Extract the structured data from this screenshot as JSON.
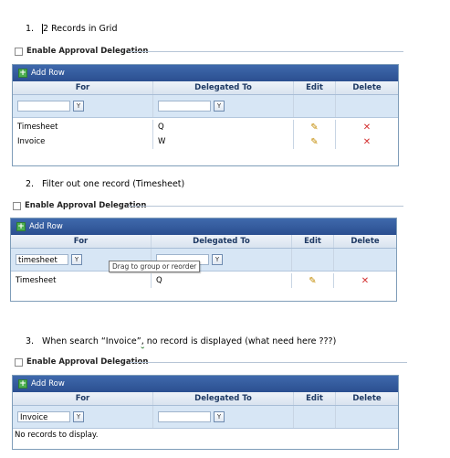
{
  "steps": [
    {
      "number": "1.",
      "cursor": "2",
      "text": " Records in Grid"
    },
    {
      "number": "2.",
      "text": "Filter out one record (Timesheet)"
    },
    {
      "number": "3.",
      "text_before": "When search “Invoice”",
      "text_mark": ",",
      "text_after": " no record is displayed (what need here ???)"
    }
  ],
  "enable_label": "Enable Approval Delegation",
  "add_row_label": "Add Row",
  "columns": {
    "for": "For",
    "delegated_to": "Delegated To",
    "edit": "Edit",
    "delete": "Delete"
  },
  "filter_icon": "funnel-icon",
  "grid1": {
    "filter_for": "",
    "filter_delegated": "",
    "rows": [
      {
        "for": "Timesheet",
        "delegated_to": "Q"
      },
      {
        "for": "Invoice",
        "delegated_to": "W"
      }
    ]
  },
  "grid2": {
    "filter_for": "timesheet",
    "filter_delegated": "",
    "tooltip": "Drag to group or reorder",
    "rows": [
      {
        "for": "Timesheet",
        "delegated_to": "Q"
      }
    ]
  },
  "grid3": {
    "filter_for": "Invoice",
    "filter_delegated": "",
    "no_records": "No records to display."
  }
}
